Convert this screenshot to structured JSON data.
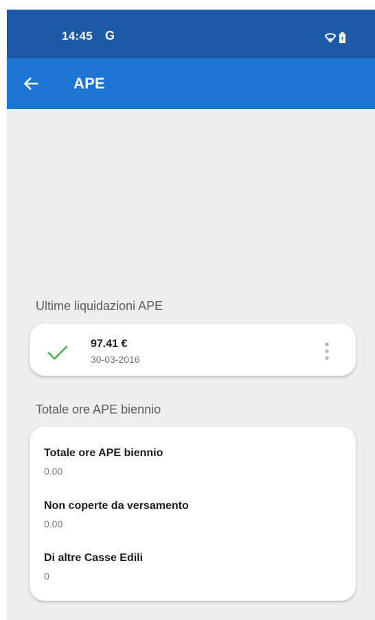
{
  "status_bar": {
    "time": "14:45",
    "notification_glyph": "G",
    "icons": [
      "wifi-icon",
      "battery-icon"
    ]
  },
  "app_bar": {
    "back_icon": "arrow-back-icon",
    "title": "APE",
    "color": "#1d75d4"
  },
  "liquidations": {
    "section_title": "Ultime liquidazioni APE",
    "items": [
      {
        "status_icon": "check-icon",
        "status_color": "#4caf50",
        "amount": "97.41 €",
        "date": "30-03-2016",
        "menu_icon": "more-vert-icon"
      }
    ]
  },
  "totals": {
    "section_title": "Totale ore APE biennio",
    "rows": [
      {
        "label": "Totale ore APE biennio",
        "value": "0.00"
      },
      {
        "label": "Non coperte da versamento",
        "value": "0.00"
      },
      {
        "label": "Di altre Casse Edili",
        "value": "0"
      }
    ]
  }
}
